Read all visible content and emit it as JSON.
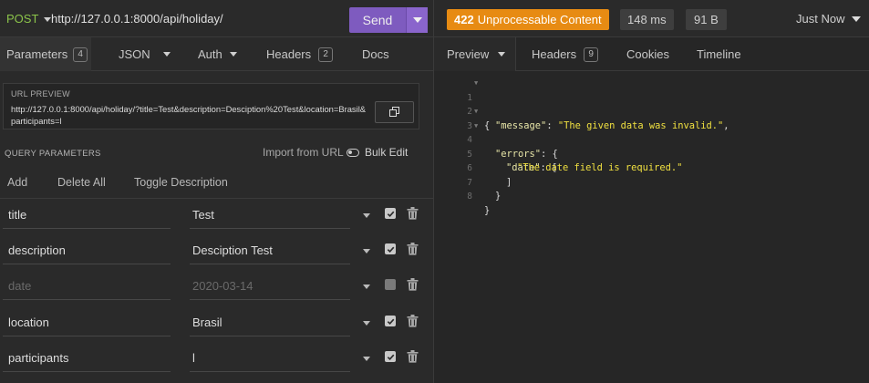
{
  "request": {
    "method": "POST",
    "url": "http://127.0.0.1:8000/api/holiday/",
    "send_label": "Send"
  },
  "request_tabs": [
    {
      "label": "Parameters",
      "badge": "4"
    },
    {
      "label": "JSON"
    },
    {
      "label": "Auth"
    },
    {
      "label": "Headers",
      "badge": "2"
    },
    {
      "label": "Docs"
    }
  ],
  "url_preview": {
    "label": "URL PREVIEW",
    "value": "http://127.0.0.1:8000/api/holiday/?title=Test&description=Desciption%20Test&location=Brasil&participants=l"
  },
  "query": {
    "title": "QUERY PARAMETERS",
    "import_label": "Import from URL",
    "bulk_label": "Bulk Edit",
    "add_label": "Add",
    "delete_all_label": "Delete All",
    "toggle_label": "Toggle Description",
    "params": [
      {
        "name": "title",
        "value": "Test",
        "enabled": true
      },
      {
        "name": "description",
        "value": "Desciption Test",
        "enabled": true
      },
      {
        "name": "date",
        "value": "2020-03-14",
        "enabled": false
      },
      {
        "name": "location",
        "value": "Brasil",
        "enabled": true
      },
      {
        "name": "participants",
        "value": "l",
        "enabled": true
      }
    ]
  },
  "response": {
    "status_code": "422",
    "status_text": "Unprocessable Content",
    "status_color": "#e78b13",
    "time": "148 ms",
    "size": "91 B",
    "when": "Just Now"
  },
  "response_tabs": [
    {
      "label": "Preview"
    },
    {
      "label": "Headers",
      "badge": "9"
    },
    {
      "label": "Cookies"
    },
    {
      "label": "Timeline"
    }
  ],
  "body": {
    "line_numbers": [
      "1",
      "2",
      "3",
      "4",
      "5",
      "6",
      "7",
      "8"
    ],
    "open_brace": "{",
    "message_key": "\"message\"",
    "message_value": "\"The given data was invalid.\"",
    "errors_key": "\"errors\"",
    "date_key": "\"date\"",
    "date_error": "\"The date field is required.\"",
    "close_bracket": "]",
    "close_inner": "}",
    "close_outer": "}"
  },
  "colors": {
    "accent": "#7e5bbf",
    "method": "#8bc34a",
    "json_string": "#f0e040"
  }
}
